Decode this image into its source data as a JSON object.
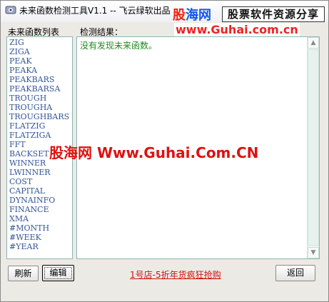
{
  "window": {
    "title": "未来函数检测工具V1.1 -- 飞云绿软出品"
  },
  "watermark": {
    "logo_red": "股",
    "logo_blue": "海网",
    "tagline": "股票软件资源分享",
    "url": "www.Guhai.com.cn",
    "center_text": "股海网 Www.Guhai.Com.CN"
  },
  "left_panel": {
    "label": "未来函数列表",
    "items": [
      "ZIG",
      "ZIGA",
      "PEAK",
      "PEAKA",
      "PEAKBARS",
      "PEAKBARSA",
      "TROUGH",
      "TROUGHA",
      "TROUGHBARS",
      "FLATZIG",
      "FLATZIGA",
      "FFT",
      "BACKSET",
      "WINNER",
      "LWINNER",
      "COST",
      "CAPITAL",
      "DYNAINFO",
      "FINANCE",
      "XMA",
      "#MONTH",
      "#WEEK",
      "#YEAR"
    ]
  },
  "right_panel": {
    "label": "检测结果：",
    "result": "没有发现未来函数。"
  },
  "buttons": {
    "refresh": "刷新",
    "edit": "编辑",
    "back": "返回"
  },
  "link": {
    "text": "1号店-5折年货疯狂抢购"
  },
  "colors": {
    "list_text": "#335599",
    "result_text": "#228822",
    "link": "#cc1111",
    "watermark_red": "#dd1111",
    "watermark_blue": "#1155ee"
  }
}
